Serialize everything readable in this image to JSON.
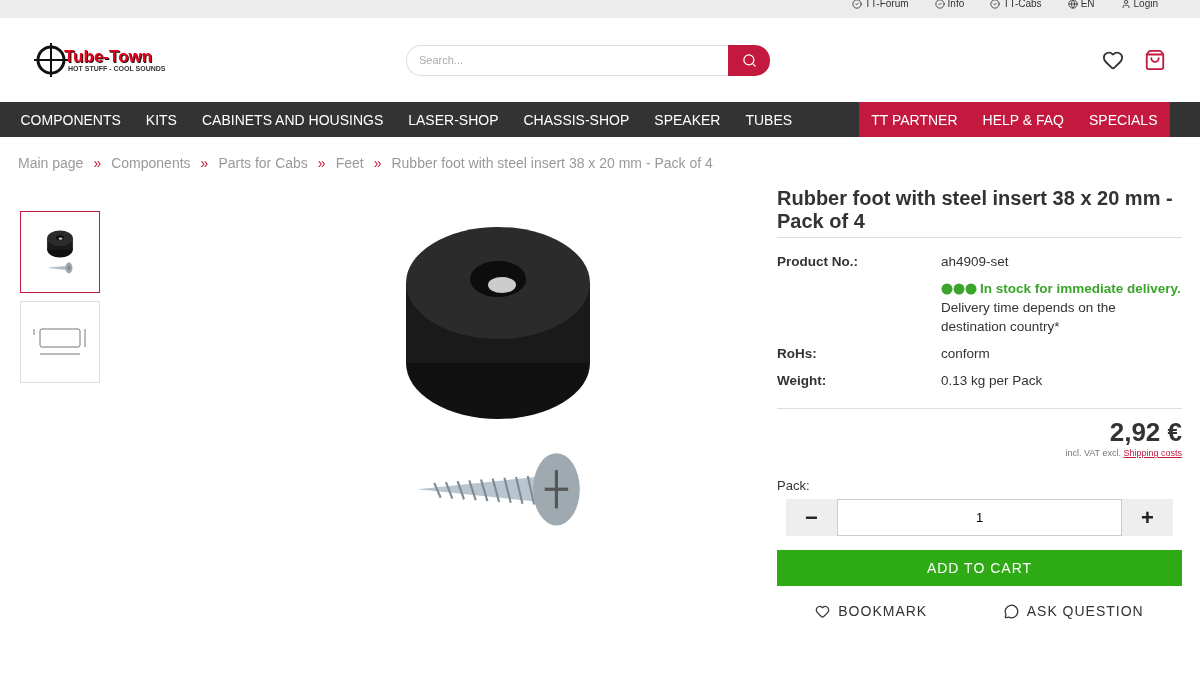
{
  "top_links": [
    {
      "kind": "check",
      "label": "TT-Forum"
    },
    {
      "kind": "check",
      "label": "Info"
    },
    {
      "kind": "check",
      "label": "TT-Cabs"
    },
    {
      "kind": "globe",
      "label": "EN"
    },
    {
      "kind": "user",
      "label": "Login"
    }
  ],
  "logo": {
    "name": "Tube-Town",
    "tagline": "HOT STUFF - COOL SOUNDS"
  },
  "search": {
    "placeholder": "Search..."
  },
  "nav": {
    "main": [
      "COMPONENTS",
      "KITS",
      "CABINETS AND HOUSINGS",
      "LASER-SHOP",
      "CHASSIS-SHOP",
      "SPEAKER",
      "TUBES"
    ],
    "highlight": [
      "TT PARTNER",
      "HELP & FAQ",
      "SPECIALS"
    ]
  },
  "breadcrumb": [
    "Main page",
    "Components",
    "Parts for Cabs",
    "Feet",
    "Rubber foot with steel insert 38 x 20 mm - Pack of 4"
  ],
  "breadcrumb_separator": "»",
  "thumbnails": [
    {
      "kind": "product",
      "selected": true
    },
    {
      "kind": "dimensions",
      "selected": false
    }
  ],
  "product": {
    "title": "Rubber foot with steel insert 38 x 20 mm - Pack of 4",
    "details": [
      {
        "label": "Product No.:",
        "value": "ah4909-set"
      },
      {
        "stock": "In stock for immediate delivery.",
        "value": "Delivery time depends on the destination country*",
        "color": "#3aa52a"
      },
      {
        "label": "RoHs:",
        "value": "conform"
      },
      {
        "label": "Weight:",
        "value": "0.13 kg per Pack"
      }
    ],
    "price": "2,92 €",
    "tax_note": "incl. VAT excl.",
    "shipping_link": "Shipping costs",
    "quantity_label": "Pack:",
    "quantity": "1",
    "minus": "−",
    "plus": "+",
    "add_to_cart": "ADD TO CART",
    "bookmark": "BOOKMARK",
    "ask_question": "ASK QUESTION"
  }
}
